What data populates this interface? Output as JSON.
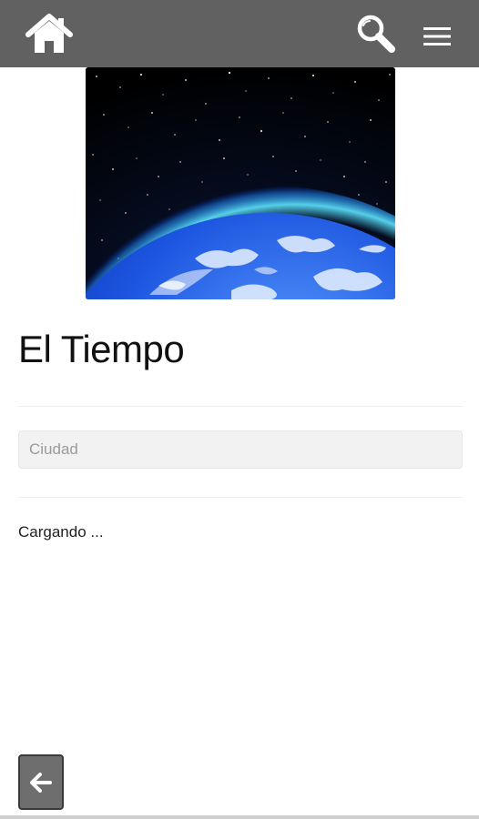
{
  "header": {
    "background_color": "#616161",
    "icon_color": "#ffffff",
    "icons": {
      "home": "home-icon",
      "search": "search-icon",
      "menu": "hamburger-menu-icon"
    }
  },
  "hero": {
    "image": "earth-from-space-image"
  },
  "main": {
    "title": "El Tiempo",
    "city_input": {
      "placeholder": "Ciudad",
      "value": ""
    },
    "status_text": "Cargando ..."
  },
  "footer": {
    "back_button_icon": "arrow-left-icon",
    "back_button_color": "#6e6e6e"
  }
}
